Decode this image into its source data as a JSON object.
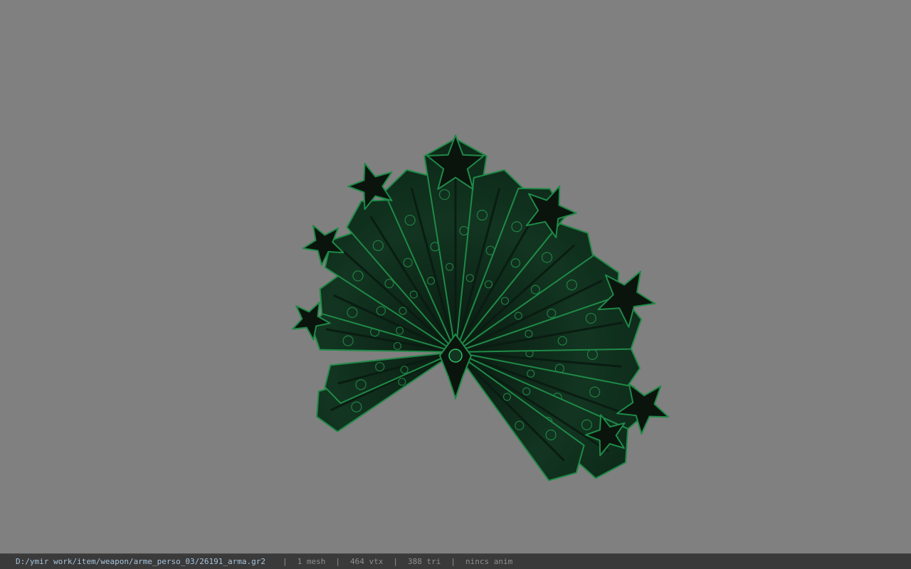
{
  "viewer": {
    "background_color": "#808080",
    "model_colors": {
      "dark": "#0a140d",
      "mid": "#123521",
      "edge": "#1f8a47",
      "glow": "#2fbf62"
    },
    "model_icon": "war-fan-model"
  },
  "status_bar": {
    "file_path": "D:/ymir work/item/weapon/arme_perso_03/26191_arma.gr2",
    "separator": "|",
    "mesh_count": "1 mesh",
    "vertex_count": "464 vtx",
    "triangle_count": "388 tri",
    "anim_status": "nincs anim"
  }
}
